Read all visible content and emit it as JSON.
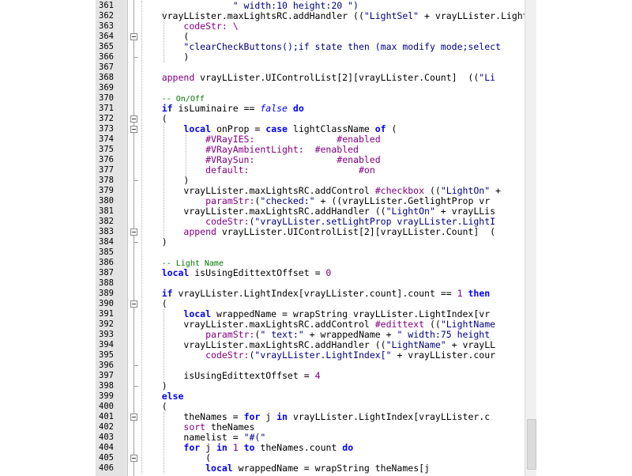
{
  "editor": {
    "gutter_start_line": 361,
    "lines": [
      [
        {
          "t": "                 "
        },
        {
          "t": "\" width:10 height:20 \")",
          "c": "s"
        }
      ],
      [
        {
          "t": "    vrayLLister.maxLightsRC.addHandler (("
        },
        {
          "t": "\"LightSel\"",
          "c": "s"
        },
        {
          "t": " + vrayLLister.LightIndex"
        }
      ],
      [
        {
          "t": "        "
        },
        {
          "t": "codeStr: \\",
          "c": "n"
        }
      ],
      [
        {
          "t": "        ("
        }
      ],
      [
        {
          "t": "        "
        },
        {
          "t": "\"clearCheckButtons();if state then (max modify mode;select",
          "c": "s"
        }
      ],
      [
        {
          "t": "        )"
        }
      ],
      [
        {
          "t": ""
        }
      ],
      [
        {
          "t": "    "
        },
        {
          "t": "append",
          "c": "n"
        },
        {
          "t": " vrayLLister.UIControlList[2][vrayLLister.Count]  (("
        },
        {
          "t": "\"Li",
          "c": "s"
        }
      ],
      [
        {
          "t": ""
        }
      ],
      [
        {
          "t": "    "
        },
        {
          "t": "-- On/Off",
          "c": "c"
        }
      ],
      [
        {
          "t": "    "
        },
        {
          "t": "if",
          "c": "k"
        },
        {
          "t": " isLuminaire == "
        },
        {
          "t": "false",
          "c": "ki"
        },
        {
          "t": " "
        },
        {
          "t": "do",
          "c": "k"
        }
      ],
      [
        {
          "t": "    ("
        }
      ],
      [
        {
          "t": "        "
        },
        {
          "t": "local",
          "c": "k"
        },
        {
          "t": " onProp = "
        },
        {
          "t": "case",
          "c": "k"
        },
        {
          "t": " lightClassName "
        },
        {
          "t": "of",
          "c": "k"
        },
        {
          "t": " ("
        }
      ],
      [
        {
          "t": "            "
        },
        {
          "t": "#VRayIES:",
          "c": "n"
        },
        {
          "t": "               "
        },
        {
          "t": "#enabled",
          "c": "n"
        }
      ],
      [
        {
          "t": "            "
        },
        {
          "t": "#VRayAmbientLight:",
          "c": "n"
        },
        {
          "t": "  "
        },
        {
          "t": "#enabled",
          "c": "n"
        }
      ],
      [
        {
          "t": "            "
        },
        {
          "t": "#VRaySun:",
          "c": "n"
        },
        {
          "t": "               "
        },
        {
          "t": "#enabled",
          "c": "n"
        }
      ],
      [
        {
          "t": "            "
        },
        {
          "t": "default:",
          "c": "n"
        },
        {
          "t": "                    "
        },
        {
          "t": "#on",
          "c": "n"
        }
      ],
      [
        {
          "t": "        )"
        }
      ],
      [
        {
          "t": "        vrayLLister.maxLightsRC.addControl "
        },
        {
          "t": "#checkbox",
          "c": "n"
        },
        {
          "t": " (("
        },
        {
          "t": "\"LightOn\"",
          "c": "s"
        },
        {
          "t": " +"
        }
      ],
      [
        {
          "t": "            "
        },
        {
          "t": "paramStr:",
          "c": "n"
        },
        {
          "t": "("
        },
        {
          "t": "\"checked:\"",
          "c": "s"
        },
        {
          "t": " + ((vrayLLister.GetlightProp vr"
        }
      ],
      [
        {
          "t": "        vrayLLister.maxLightsRC.addHandler (("
        },
        {
          "t": "\"LightOn\"",
          "c": "s"
        },
        {
          "t": " + vrayLLis"
        }
      ],
      [
        {
          "t": "            "
        },
        {
          "t": "codeStr:",
          "c": "n"
        },
        {
          "t": "("
        },
        {
          "t": "\"vrayLLister.setLightProp vrayLLister.LightI",
          "c": "s"
        }
      ],
      [
        {
          "t": "        "
        },
        {
          "t": "append",
          "c": "n"
        },
        {
          "t": " vrayLLister.UIControlList[2][vrayLLister.Count]  ("
        }
      ],
      [
        {
          "t": "    )"
        }
      ],
      [
        {
          "t": ""
        }
      ],
      [
        {
          "t": "    "
        },
        {
          "t": "-- Light Name",
          "c": "c"
        }
      ],
      [
        {
          "t": "    "
        },
        {
          "t": "local",
          "c": "k"
        },
        {
          "t": " isUsingEdittextOffset = "
        },
        {
          "t": "0",
          "c": "n"
        }
      ],
      [
        {
          "t": ""
        }
      ],
      [
        {
          "t": "    "
        },
        {
          "t": "if",
          "c": "k"
        },
        {
          "t": " vrayLLister.LightIndex[vrayLLister.count].count == "
        },
        {
          "t": "1",
          "c": "n"
        },
        {
          "t": " "
        },
        {
          "t": "then",
          "c": "k"
        }
      ],
      [
        {
          "t": "    ("
        }
      ],
      [
        {
          "t": "        "
        },
        {
          "t": "local",
          "c": "k"
        },
        {
          "t": " wrappedName = wrapString vrayLLister.LightIndex[vr"
        }
      ],
      [
        {
          "t": "        vrayLLister.maxLightsRC.addControl "
        },
        {
          "t": "#edittext",
          "c": "n"
        },
        {
          "t": " (("
        },
        {
          "t": "\"LightName",
          "c": "s"
        }
      ],
      [
        {
          "t": "            "
        },
        {
          "t": "paramStr:",
          "c": "n"
        },
        {
          "t": "("
        },
        {
          "t": "\" text:\"",
          "c": "s"
        },
        {
          "t": " + wrappedName + "
        },
        {
          "t": "\" width:75 height",
          "c": "s"
        }
      ],
      [
        {
          "t": "        vrayLLister.maxLightsRC.addHandler (("
        },
        {
          "t": "\"LightName\"",
          "c": "s"
        },
        {
          "t": " + vrayLL"
        }
      ],
      [
        {
          "t": "            "
        },
        {
          "t": "codeStr:",
          "c": "n"
        },
        {
          "t": "("
        },
        {
          "t": "\"vrayLLister.LightIndex[\"",
          "c": "s"
        },
        {
          "t": " + vrayLLister.cour"
        }
      ],
      [
        {
          "t": ""
        }
      ],
      [
        {
          "t": "        isUsingEdittextOffset = "
        },
        {
          "t": "4",
          "c": "n"
        }
      ],
      [
        {
          "t": "    )"
        }
      ],
      [
        {
          "t": "    "
        },
        {
          "t": "else",
          "c": "k"
        }
      ],
      [
        {
          "t": "    ("
        }
      ],
      [
        {
          "t": "        theNames = "
        },
        {
          "t": "for",
          "c": "k"
        },
        {
          "t": " j "
        },
        {
          "t": "in",
          "c": "k"
        },
        {
          "t": " vrayLLister.LightIndex[vrayLLister.c"
        }
      ],
      [
        {
          "t": "        "
        },
        {
          "t": "sort",
          "c": "n"
        },
        {
          "t": " theNames"
        }
      ],
      [
        {
          "t": "        namelist = "
        },
        {
          "t": "\"#(\"",
          "c": "s"
        }
      ],
      [
        {
          "t": "        "
        },
        {
          "t": "for",
          "c": "k"
        },
        {
          "t": " j "
        },
        {
          "t": "in",
          "c": "k"
        },
        {
          "t": " "
        },
        {
          "t": "1",
          "c": "n"
        },
        {
          "t": " "
        },
        {
          "t": "to",
          "c": "k"
        },
        {
          "t": " theNames.count "
        },
        {
          "t": "do",
          "c": "k"
        }
      ],
      [
        {
          "t": "            ("
        }
      ],
      [
        {
          "t": "            "
        },
        {
          "t": "local",
          "c": "k"
        },
        {
          "t": " wrappedName = wrapString theNames[j"
        }
      ]
    ],
    "fold_marker_lines": [
      364,
      372,
      373,
      383,
      390,
      401,
      405
    ],
    "colors": {
      "keyword": "#0000ff",
      "string": "#000080",
      "name": "#800080",
      "comment": "#007700",
      "gutter_bg": "#e4e4e4"
    }
  }
}
